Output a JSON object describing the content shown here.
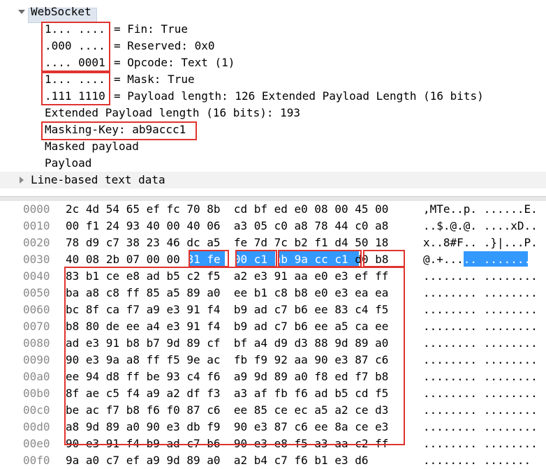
{
  "detail": {
    "top_cut_text": "",
    "websocket_title": "WebSocket",
    "fields": [
      {
        "bits": "1... ....",
        "label": "= Fin: True"
      },
      {
        "bits": ".000 ....",
        "label": "= Reserved: 0x0"
      },
      {
        "bits": ".... 0001",
        "label": "= Opcode: Text (1)"
      },
      {
        "bits": "1... ....",
        "label": "= Mask: True"
      },
      {
        "bits": ".111 1110",
        "label": "= Payload length: 126 Extended Payload Length (16 bits)"
      }
    ],
    "ext_payload": "Extended Payload length (16 bits): 193",
    "masking_key": "Masking-Key: ab9accc1",
    "masked_payload": "Masked payload",
    "payload": "Payload",
    "line_based": "Line-based text data"
  },
  "bytes": {
    "rows": [
      {
        "offset": "0000",
        "hex": "2c 4d 54 65 ef fc 70 8b  cd bf ed e0 08 00 45 00",
        "ascii": ",MTe..p. ......E."
      },
      {
        "offset": "0010",
        "hex": "00 f1 24 93 40 00 40 06  a3 05 c0 a8 78 44 c0 a8",
        "ascii": "..$.@.@. ....xD.."
      },
      {
        "offset": "0020",
        "hex": "78 d9 c7 38 23 46 dc a5  fe 7d 7c b2 f1 d4 50 18",
        "ascii": "x..8#F.. .}|...P."
      },
      {
        "offset": "0030",
        "hex": "40 08 2b 07 00 00 81 fe  00 c1 ab 9a cc c1 d0 b8",
        "ascii": "@.+..... ........"
      },
      {
        "offset": "0040",
        "hex": "83 b1 ce e8 ad b5 c2 f5  a2 e3 91 aa e0 e3 ef ff",
        "ascii": "........ ........"
      },
      {
        "offset": "0050",
        "hex": "ba a8 c8 ff 85 a5 89 a0  ee b1 c8 b8 e0 e3 ea ea",
        "ascii": "........ ........"
      },
      {
        "offset": "0060",
        "hex": "bc 8f ca f7 a9 e3 91 f4  b9 ad c7 b6 ee 83 c4 f5",
        "ascii": "........ ........"
      },
      {
        "offset": "0070",
        "hex": "b8 80 de ee a4 e3 91 f4  b9 ad c7 b6 ee a5 ca ee",
        "ascii": "........ ........"
      },
      {
        "offset": "0080",
        "hex": "ad e3 91 b8 b7 9d 89 cf  bf a4 d9 d3 88 9d 89 a0",
        "ascii": "........ ........"
      },
      {
        "offset": "0090",
        "hex": "90 e3 9a a8 ff f5 9e ac  fb f9 92 aa 90 e3 87 c6",
        "ascii": "........ ........"
      },
      {
        "offset": "00a0",
        "hex": "ee 94 d8 ff be 93 c4 f6  a9 9d 89 a0 f8 ed f7 b8",
        "ascii": "........ ........"
      },
      {
        "offset": "00b0",
        "hex": "8f ae c5 f4 a9 a2 df f3  a3 af fb f6 ad b5 cd f5",
        "ascii": "........ ........"
      },
      {
        "offset": "00c0",
        "hex": "be ac f7 b8 f6 f0 87 c6  ee 85 ce ec a5 a2 ce d3",
        "ascii": "........ ........"
      },
      {
        "offset": "00d0",
        "hex": "a8 9d 89 a0 90 e3 db f9  90 e3 87 c6 ee 8a ce e3",
        "ascii": "........ ........"
      },
      {
        "offset": "00e0",
        "hex": "90 e3 91 f4 b9 ad c7 b6  90 e3 e8 f5 a3 aa c2 ff",
        "ascii": "........ ........"
      },
      {
        "offset": "00f0",
        "hex": "9a a0 c7 ef a9 9d 89 a0  a2 b4 c7 f6 b1 e3 d6",
        "ascii": "........ ......."
      }
    ],
    "selected_hex_0030": [
      "81",
      "fe",
      "00",
      "c1",
      "ab",
      "9a",
      "cc",
      "c1"
    ]
  },
  "colors": {
    "annotation_red": "#e0332e",
    "selection_blue": "#3399ff"
  }
}
